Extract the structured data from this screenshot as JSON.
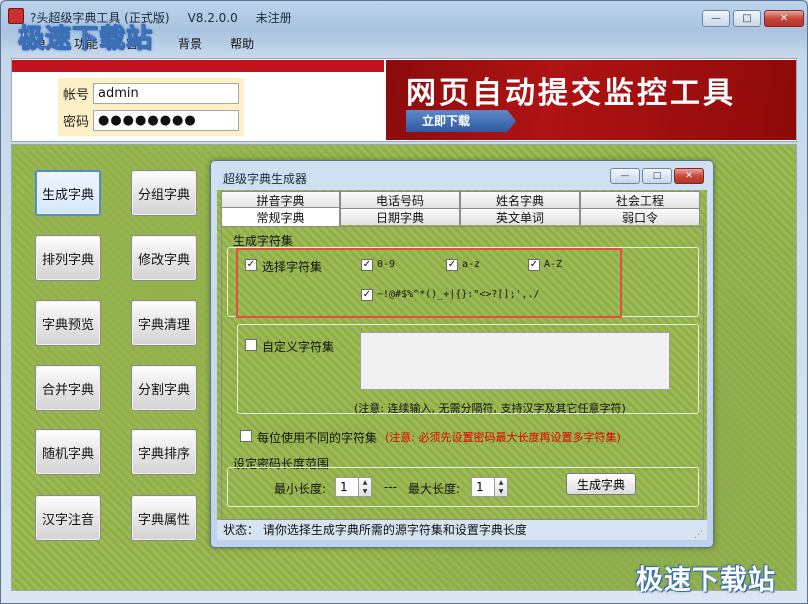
{
  "window": {
    "title": "?头超级字典工具 (正式版)",
    "version": "V8.2.0.0",
    "registration": "未注册",
    "controls": {
      "min": "—",
      "max": "□",
      "close": "✕"
    }
  },
  "watermark": {
    "top": "极速下载站",
    "bottom": "极速下载站"
  },
  "menu": [
    "菜单",
    "功能",
    "窗口",
    "背景",
    "帮助"
  ],
  "login": {
    "account_label": "帐号",
    "account_value": "admin",
    "password_label": "密码",
    "password_value": "●●●●●●●●"
  },
  "banner": {
    "title": "网页自动提交监控工具",
    "button": "立即下载"
  },
  "side_buttons": [
    "生成字典",
    "分组字典",
    "排列字典",
    "修改字典",
    "字典预览",
    "字典清理",
    "合并字典",
    "分割字典",
    "随机字典",
    "字典排序",
    "汉字注音",
    "字典属性"
  ],
  "dialog": {
    "title": "超级字典生成器",
    "controls": {
      "min": "—",
      "max": "□",
      "close": "✕"
    },
    "tabs_row1": [
      "拼音字典",
      "电话号码",
      "姓名字典",
      "社会工程"
    ],
    "tabs_row2": [
      "常规字典",
      "日期字典",
      "英文单词",
      "弱口令"
    ],
    "charset_group": {
      "title": "生成字符集",
      "select_label": "选择字符集",
      "options": [
        "0-9",
        "a-z",
        "A-Z"
      ],
      "symbols": "~!@#$%^*()_+|{}:\"<>?[];',./"
    },
    "custom_group": {
      "label": "自定义字符集",
      "note": "(注意: 连续输入, 无需分隔符, 支持汉字及其它任意字符)"
    },
    "per_position": {
      "label": "每位使用不同的字符集",
      "warning": "(注意: 必须先设置密码最大长度再设置多字符集)"
    },
    "length_group": {
      "title": "设定密码长度范围",
      "min_label": "最小长度:",
      "min_value": "1",
      "separator": "---",
      "max_label": "最大长度:",
      "max_value": "1",
      "generate_button": "生成字典"
    },
    "status": "状态： 请你选择生成字典所需的源字符集和设置字典长度"
  },
  "colors": {
    "banner_red": "#b01313",
    "highlight": "#e0523e",
    "warning_red": "#e00000"
  }
}
